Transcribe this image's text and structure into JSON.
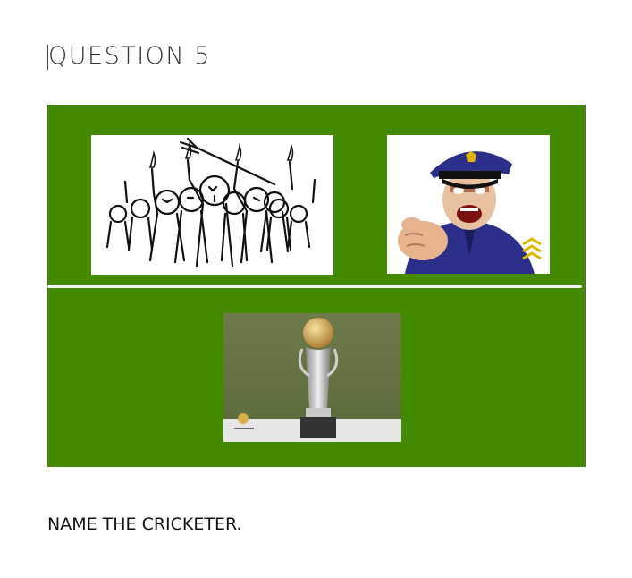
{
  "question_heading": "QUESTION 5",
  "prompt": "NAME THE CRICKETER.",
  "colors": {
    "panel": "#448a00",
    "divider": "#f2f2f2"
  },
  "images": {
    "clue_1": "angry-mob-cartoon",
    "clue_2": "shouting-police-officer-cartoon",
    "clue_3": "champions-trophy"
  }
}
